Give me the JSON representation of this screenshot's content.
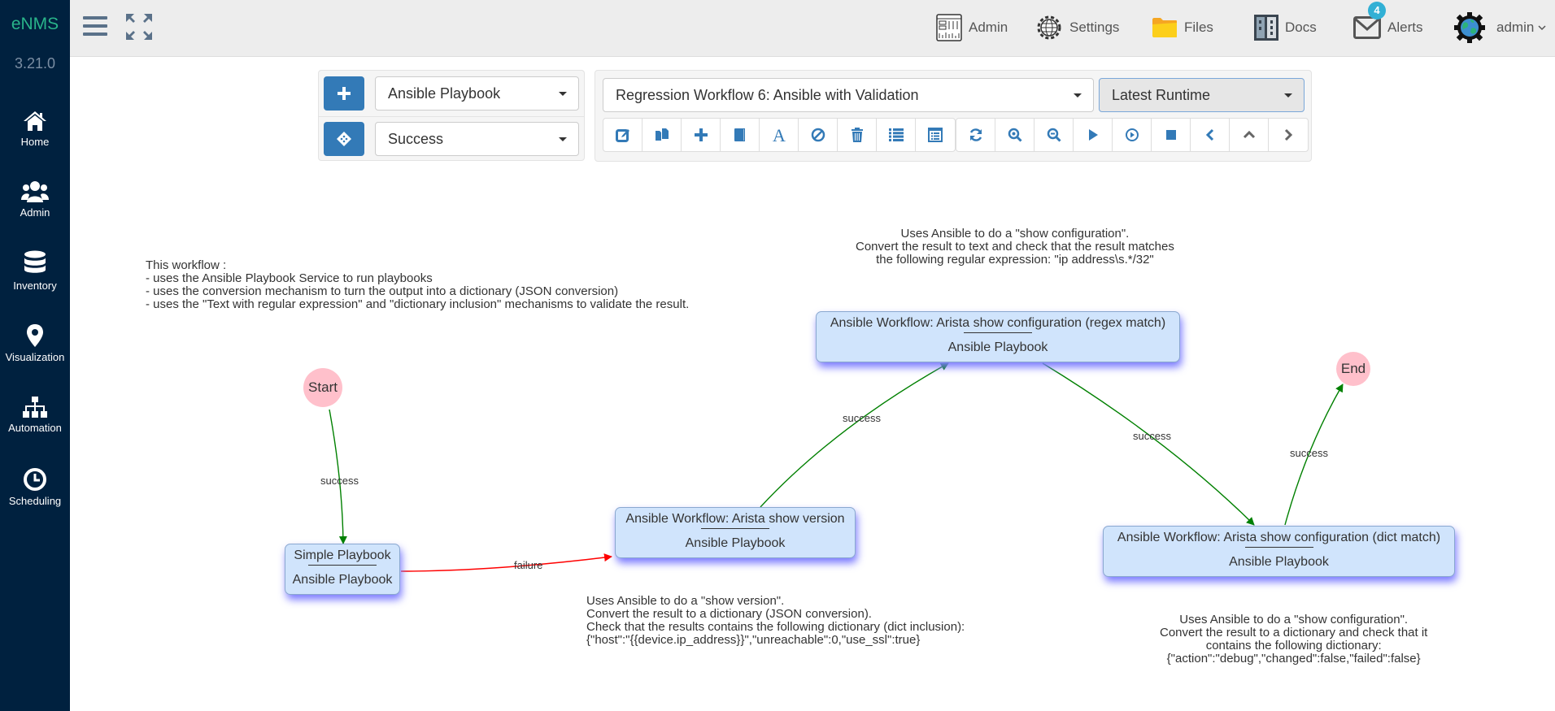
{
  "sidebar": {
    "brand": "eNMS",
    "version": "3.21.0",
    "items": [
      {
        "label": "Home",
        "icon": "home-icon"
      },
      {
        "label": "Admin",
        "icon": "users-icon"
      },
      {
        "label": "Inventory",
        "icon": "database-icon"
      },
      {
        "label": "Visualization",
        "icon": "map-marker-icon"
      },
      {
        "label": "Automation",
        "icon": "sitemap-icon"
      },
      {
        "label": "Scheduling",
        "icon": "clock-icon"
      }
    ]
  },
  "topbar": {
    "items": [
      {
        "label": "Admin",
        "icon": "admin-panel-icon"
      },
      {
        "label": "Settings",
        "icon": "settings-gear-icon"
      },
      {
        "label": "Files",
        "icon": "folder-icon"
      },
      {
        "label": "Docs",
        "icon": "docs-icon"
      },
      {
        "label": "Alerts",
        "icon": "envelope-icon",
        "badge": "4"
      },
      {
        "label": "admin",
        "icon": "user-globe-icon"
      }
    ]
  },
  "controls": {
    "service_type": "Ansible Playbook",
    "edge_type": "Success",
    "workflow": "Regression Workflow 6: Ansible with Validation",
    "runtime": "Latest Runtime",
    "toolbar_left": [
      "edit-icon",
      "duplicate-icon",
      "add-icon",
      "book-icon",
      "font-icon",
      "ban-icon",
      "trash-icon",
      "list-icon",
      "list-alt-icon"
    ],
    "toolbar_right": [
      "refresh-icon",
      "zoom-in-icon",
      "zoom-out-icon",
      "play-icon",
      "play-circle-icon",
      "stop-icon",
      "chevron-left-icon",
      "chevron-up-icon",
      "chevron-right-icon"
    ]
  },
  "workflow": {
    "description": "This workflow :\n- uses the Ansible Playbook Service to run playbooks\n- uses the conversion mechanism to turn the output into a dictionary (JSON conversion)\n- uses the \"Text with regular expression\" and \"dictionary inclusion\" mechanisms to validate the result.",
    "notes": {
      "regex": "Uses Ansible to do a \"show configuration\".\nConvert the result to text and check that the result matches\nthe following regular expression: \"ip address\\s.*/32\"",
      "version": "Uses Ansible to do a \"show version\".\nConvert the result to a dictionary (JSON conversion).\nCheck that the results contains the following dictionary (dict inclusion):\n{\"host\":\"{{device.ip_address}}\",\"unreachable\":0,\"use_ssl\":true}",
      "dict": "Uses Ansible to do a \"show configuration\".\nConvert the result to a dictionary and check that it\ncontains the following dictionary:\n{\"action\":\"debug\",\"changed\":false,\"failed\":false}"
    },
    "start_label": "Start",
    "end_label": "End",
    "nodes": [
      {
        "name": "Simple Playbook",
        "type": "Ansible Playbook"
      },
      {
        "name": "Ansible Workflow: Arista show version",
        "type": "Ansible Playbook"
      },
      {
        "name": "Ansible Workflow: Arista show configuration (regex match)",
        "type": "Ansible Playbook"
      },
      {
        "name": "Ansible Workflow: Arista show configuration (dict match)",
        "type": "Ansible Playbook"
      }
    ],
    "edges": [
      {
        "label": "success",
        "color": "#008000"
      },
      {
        "label": "failure",
        "color": "#ff0000"
      },
      {
        "label": "success",
        "color": "#008000"
      },
      {
        "label": "success",
        "color": "#008000"
      },
      {
        "label": "success",
        "color": "#008000"
      }
    ]
  }
}
